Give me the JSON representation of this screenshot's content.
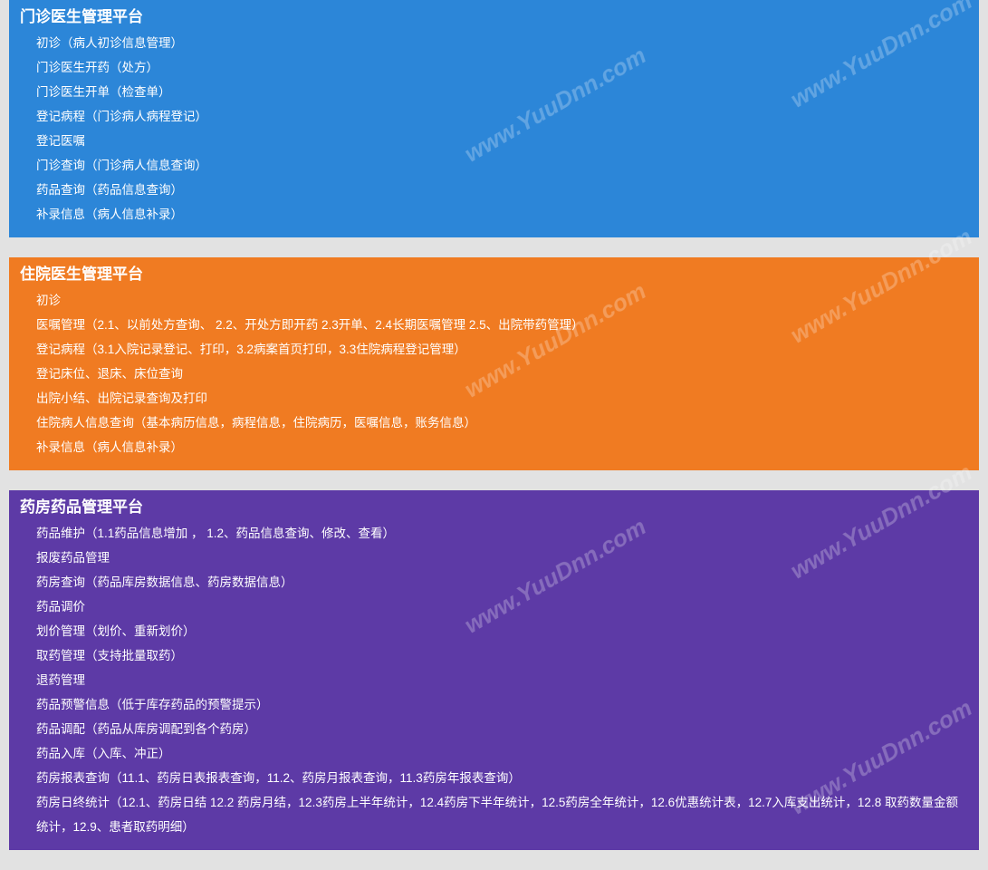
{
  "watermark": "www.YuuDnn.com",
  "sections": [
    {
      "title": "门诊医生管理平台",
      "color": "#2c86d8",
      "items": [
        "初诊（病人初诊信息管理）",
        "门诊医生开药（处方）",
        "门诊医生开单（检查单）",
        "登记病程（门诊病人病程登记）",
        "登记医嘱",
        "门诊查询（门诊病人信息查询）",
        "药品查询（药品信息查询）",
        "补录信息（病人信息补录）"
      ]
    },
    {
      "title": "住院医生管理平台",
      "color": "#f07b22",
      "items": [
        "初诊",
        "医嘱管理（2.1、以前处方查询、 2.2、开处方即开药 2.3开单、2.4长期医嘱管理 2.5、出院带药管理）",
        "登记病程（3.1入院记录登记、打印，3.2病案首页打印，3.3住院病程登记管理）",
        "登记床位、退床、床位查询",
        "出院小结、出院记录查询及打印",
        "住院病人信息查询（基本病历信息，病程信息，住院病历，医嘱信息，账务信息）",
        "补录信息（病人信息补录）"
      ]
    },
    {
      "title": "药房药品管理平台",
      "color": "#5d3aa6",
      "items": [
        "药品维护（1.1药品信息增加 ， 1.2、药品信息查询、修改、查看）",
        "报废药品管理",
        "药房查询（药品库房数据信息、药房数据信息）",
        "药品调价",
        "划价管理（划价、重新划价）",
        "取药管理（支持批量取药）",
        "退药管理",
        "药品预警信息（低于库存药品的预警提示）",
        "药品调配（药品从库房调配到各个药房）",
        "药品入库（入库、冲正）",
        "药房报表查询（11.1、药房日表报表查询，11.2、药房月报表查询，11.3药房年报表查询）",
        "药房日终统计（12.1、药房日结 12.2 药房月结，12.3药房上半年统计，12.4药房下半年统计，12.5药房全年统计，12.6优惠统计表，12.7入库支出统计，12.8 取药数量金额统计，12.9、患者取药明细）"
      ]
    }
  ]
}
